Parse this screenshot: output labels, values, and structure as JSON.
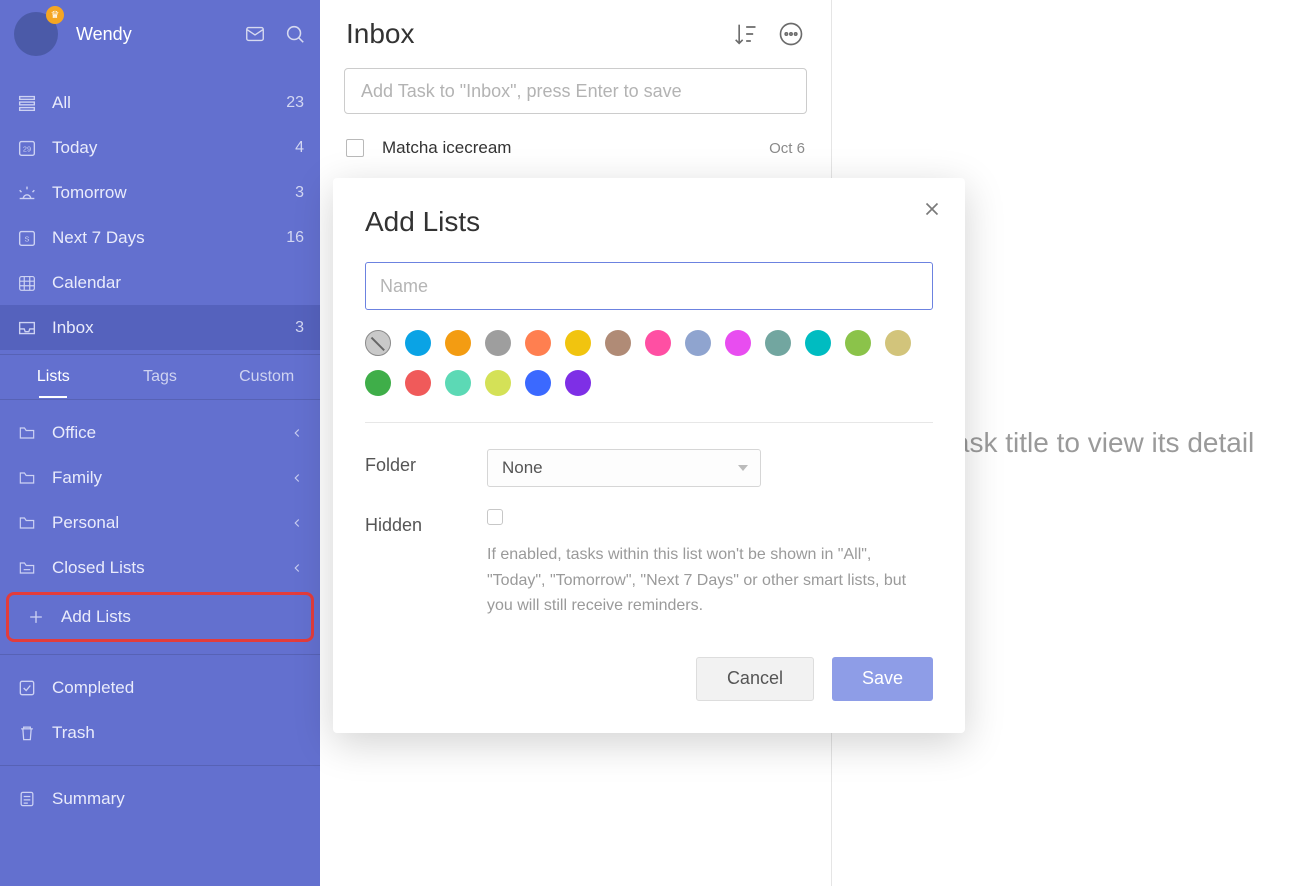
{
  "user": {
    "name": "Wendy"
  },
  "smartLists": [
    {
      "key": "all",
      "label": "All",
      "count": 23
    },
    {
      "key": "today",
      "label": "Today",
      "count": 4,
      "dateNum": "29"
    },
    {
      "key": "tomorrow",
      "label": "Tomorrow",
      "count": 3
    },
    {
      "key": "next7",
      "label": "Next 7 Days",
      "count": 16
    },
    {
      "key": "calendar",
      "label": "Calendar",
      "count": ""
    },
    {
      "key": "inbox",
      "label": "Inbox",
      "count": 3,
      "active": true
    }
  ],
  "tabs": {
    "lists": "Lists",
    "tags": "Tags",
    "custom": "Custom"
  },
  "userLists": [
    {
      "label": "Office"
    },
    {
      "label": "Family"
    },
    {
      "label": "Personal"
    },
    {
      "label": "Closed Lists"
    }
  ],
  "addLists_label": "Add Lists",
  "footerLists": {
    "completed": "Completed",
    "trash": "Trash",
    "summary": "Summary"
  },
  "inbox": {
    "title": "Inbox",
    "addTask_placeholder": "Add Task to \"Inbox\", press Enter to save",
    "tasks": [
      {
        "title": "Matcha icecream",
        "due": "Oct 6"
      }
    ]
  },
  "detailHint": "Click task title to view its detail",
  "modal": {
    "title": "Add Lists",
    "name_placeholder": "Name",
    "colors": [
      "none",
      "#0aa3e5",
      "#f39c12",
      "#9e9e9e",
      "#ff7f50",
      "#f1c40f",
      "#b08b76",
      "#ff4fa3",
      "#8fa4cf",
      "#e84df0",
      "#72a6a0",
      "#00bcc1",
      "#8bc34a",
      "#d2c47b",
      "#3fae49",
      "#f05a5a",
      "#5cd9b5",
      "#d4e157",
      "#3b69ff",
      "#7e2fe6"
    ],
    "folder_label": "Folder",
    "folder_value": "None",
    "hidden_label": "Hidden",
    "hidden_help": "If enabled, tasks within this list won't be shown in \"All\", \"Today\", \"Tomorrow\", \"Next 7 Days\" or other smart lists, but you will still receive reminders.",
    "cancel": "Cancel",
    "save": "Save"
  }
}
